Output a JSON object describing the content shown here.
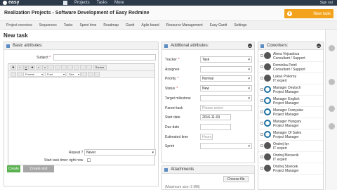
{
  "topbar": {
    "logo": "easy",
    "nav": [
      "Projects",
      "Tasks",
      "More"
    ],
    "signout": "Sign out"
  },
  "project": {
    "title": "Realization Projects - Software Development of Easy Redmine",
    "new_task_label": "New task"
  },
  "tabs": [
    "Project overview",
    "Sequences",
    "Tasks",
    "Spent time",
    "Roadmap",
    "Gantt",
    "Agile board",
    "Resource Management",
    "Easy Gantt",
    "Settings"
  ],
  "page_title": "New task",
  "basic": {
    "header": "Basic attributes:",
    "subject_label": "Subject",
    "toolbar1": [
      "B",
      "I",
      "U",
      "S",
      "x",
      "x",
      "",
      "",
      "",
      "",
      "",
      "",
      "",
      "Source"
    ],
    "format_dd": "Format",
    "font_dd": "Font",
    "size_dd": "Size",
    "repeat_label": "Repeat ?",
    "repeat_value": "Never",
    "timer_label": "Start task timer right now",
    "create_label": "Create",
    "create_continue_label": "Create and continue"
  },
  "additional": {
    "header": "Additional attributes:",
    "fields": [
      {
        "label": "Tracker",
        "req": "*",
        "value": "Task",
        "type": "select"
      },
      {
        "label": "Assignee",
        "req": "",
        "value": "",
        "type": "select"
      },
      {
        "label": "Priority",
        "req": "*",
        "value": "Normal",
        "type": "select"
      },
      {
        "label": "Status",
        "req": "*",
        "value": "New",
        "type": "select"
      },
      {
        "label": "Target milestone",
        "req": "",
        "value": "",
        "type": "select"
      },
      {
        "label": "Parent task",
        "req": "",
        "value": "Please select",
        "type": "input"
      },
      {
        "label": "Start date",
        "req": "",
        "value": "2016-11-03",
        "type": "input"
      },
      {
        "label": "Due date",
        "req": "",
        "value": "",
        "type": "input"
      },
      {
        "label": "Estimated time",
        "req": "",
        "value": "Hours",
        "type": "input"
      },
      {
        "label": "Sprint",
        "req": "",
        "value": "",
        "type": "select"
      }
    ]
  },
  "attachments": {
    "header": "Attachments",
    "choose": "Choose file",
    "hint": "(Maximum size: 5 MB)"
  },
  "coworkers": {
    "header": "Coworkers:",
    "list": [
      {
        "name": "Alena Vejsadova",
        "role": "Consultant / Support",
        "logo": false
      },
      {
        "name": "Dominika Petril",
        "role": "Consultant / Support",
        "logo": false
      },
      {
        "name": "Lukas Pokorny",
        "role": "IT expert",
        "logo": false
      },
      {
        "name": "Manager Deutsch",
        "role": "Project Manager",
        "logo": true
      },
      {
        "name": "Manager English",
        "role": "Project Manager",
        "logo": true
      },
      {
        "name": "Manager Française",
        "role": "Project Manager",
        "logo": true
      },
      {
        "name": "Manager Hungary",
        "role": "Project Manager",
        "logo": true
      },
      {
        "name": "Manager Of Sales",
        "role": "Project Manager",
        "logo": true
      },
      {
        "name": "Ondrej Ipr",
        "role": "IT expert",
        "logo": false
      },
      {
        "name": "Ondrej Moravcik",
        "role": "IT expert",
        "logo": false
      },
      {
        "name": "Ondrej Stovicek",
        "role": "Project Manager",
        "logo": false
      }
    ]
  }
}
